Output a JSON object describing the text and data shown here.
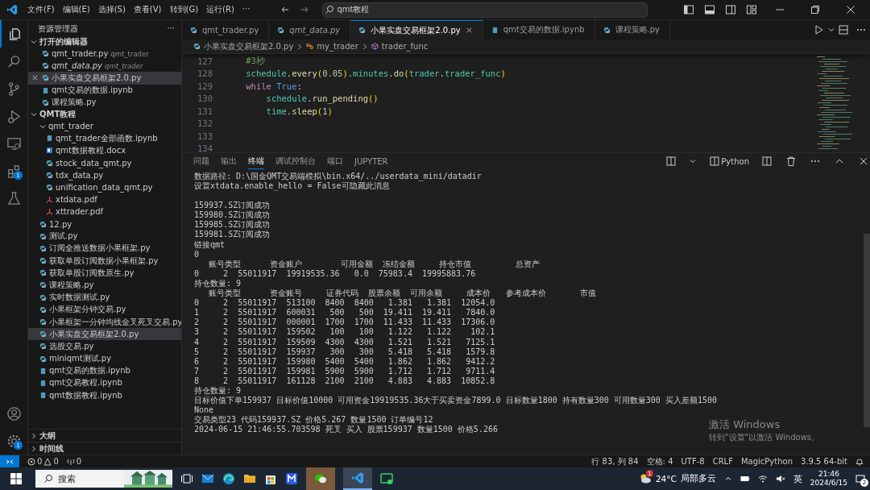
{
  "menu": [
    "文件(F)",
    "编辑(E)",
    "选择(S)",
    "查看(V)",
    "转到(G)",
    "运行(R)",
    "···"
  ],
  "command_center": {
    "value": "qmt教程"
  },
  "activity_bar": {
    "extensions_badge": "1",
    "settings_badge": "1"
  },
  "sidebar": {
    "title": "资源管理器",
    "more": "···",
    "open_editors": {
      "title": "打开的编辑器",
      "expanded": true,
      "items": [
        {
          "name": "qmt_trader.py",
          "folder": "qmt_trader",
          "kind": "py",
          "preview": false,
          "selected": false
        },
        {
          "name": "qmt_data.py",
          "folder": "qmt_trader",
          "kind": "py",
          "preview": true,
          "selected": false
        },
        {
          "name": "小果实盘交易框架2.0.py",
          "kind": "py",
          "preview": false,
          "selected": true
        },
        {
          "name": "qmt交易的数据.ipynb",
          "kind": "ipynb",
          "preview": false,
          "selected": false
        },
        {
          "name": "课程策略.py",
          "kind": "py",
          "preview": false,
          "selected": false
        }
      ]
    },
    "folder": {
      "title": "QMT教程",
      "expanded": true,
      "items": [
        {
          "name": "qmt_trader",
          "kind": "folder",
          "expanded": true,
          "selected": false,
          "children": [
            {
              "name": "qmt_trader全部函数.ipynb",
              "kind": "ipynb",
              "selected": false
            },
            {
              "name": "qmt数据教程.docx",
              "kind": "docx",
              "selected": false
            },
            {
              "name": "stock_data_qmt.py",
              "kind": "py",
              "selected": false
            },
            {
              "name": "tdx_data.py",
              "kind": "py",
              "selected": false
            },
            {
              "name": "unification_data_qmt.py",
              "kind": "py",
              "selected": false
            },
            {
              "name": "xtdata.pdf",
              "kind": "pdf",
              "selected": false
            },
            {
              "name": "xttrader.pdf",
              "kind": "pdf",
              "selected": false
            }
          ]
        },
        {
          "name": "12.py",
          "kind": "py",
          "selected": false
        },
        {
          "name": "测试.py",
          "kind": "py",
          "selected": false
        },
        {
          "name": "订阅全推送数据小果框架.py",
          "kind": "py",
          "selected": false
        },
        {
          "name": "获取单股订阅数据小果框架.py",
          "kind": "py",
          "selected": false
        },
        {
          "name": "获取单股订阅数原生.py",
          "kind": "py",
          "selected": false
        },
        {
          "name": "课程策略.py",
          "kind": "py",
          "selected": false
        },
        {
          "name": "实时数据测试.py",
          "kind": "py",
          "selected": false
        },
        {
          "name": "小果框架分钟交易.py",
          "kind": "py",
          "selected": false
        },
        {
          "name": "小果框架一分钟均线金叉死叉交易.py",
          "kind": "py",
          "selected": false
        },
        {
          "name": "小果实盘交易框架2.0.py",
          "kind": "py",
          "selected": true
        },
        {
          "name": "选股交易.py",
          "kind": "py",
          "selected": false
        },
        {
          "name": "miniqmt测试.py",
          "kind": "py",
          "selected": false
        },
        {
          "name": "qmt交易的数据.ipynb",
          "kind": "ipynb",
          "selected": false
        },
        {
          "name": "qmt交易教程.ipynb",
          "kind": "ipynb",
          "selected": false
        },
        {
          "name": "qmt数据教程.ipynb",
          "kind": "ipynb",
          "selected": false
        }
      ]
    },
    "sections": [
      {
        "title": "大纲",
        "expanded": false
      },
      {
        "title": "时间线",
        "expanded": false
      }
    ]
  },
  "tabs": [
    {
      "label": "qmt_trader.py",
      "kind": "py",
      "preview": false,
      "selected": false
    },
    {
      "label": "qmt_data.py",
      "kind": "py",
      "preview": true,
      "selected": false
    },
    {
      "label": "小果实盘交易框架2.0.py",
      "kind": "py",
      "preview": false,
      "selected": true
    },
    {
      "label": "qmt交易的数据.ipynb",
      "kind": "ipynb",
      "preview": false,
      "selected": false
    },
    {
      "label": "课程策略.py",
      "kind": "py",
      "preview": false,
      "selected": false
    }
  ],
  "breadcrumb": [
    "小果实盘交易框架2.0.py",
    "my_trader",
    "trader_func"
  ],
  "code": [
    {
      "number": "127",
      "tokens": [
        {
          "text": "    #3秒",
          "kind": "comment"
        }
      ]
    },
    {
      "number": "128",
      "tokens": [
        {
          "text": "    schedule",
          "kind": "var"
        },
        {
          "text": ".",
          "kind": "plain"
        },
        {
          "text": "every",
          "kind": "func"
        },
        {
          "text": "(",
          "kind": "paren"
        },
        {
          "text": "0.05",
          "kind": "num"
        },
        {
          "text": ")",
          "kind": "paren"
        },
        {
          "text": ".",
          "kind": "plain"
        },
        {
          "text": "minutes",
          "kind": "var"
        },
        {
          "text": ".",
          "kind": "plain"
        },
        {
          "text": "do",
          "kind": "func"
        },
        {
          "text": "(",
          "kind": "paren"
        },
        {
          "text": "trader",
          "kind": "var"
        },
        {
          "text": ".",
          "kind": "plain"
        },
        {
          "text": "trader_func",
          "kind": "var"
        },
        {
          "text": ")",
          "kind": "paren"
        }
      ]
    },
    {
      "number": "129",
      "tokens": [
        {
          "text": "    while",
          "kind": "kw"
        },
        {
          "text": " True",
          "kind": "const"
        },
        {
          "text": ":",
          "kind": "plain"
        }
      ]
    },
    {
      "number": "130",
      "tokens": [
        {
          "text": "        schedule",
          "kind": "var"
        },
        {
          "text": ".",
          "kind": "plain"
        },
        {
          "text": "run_pending",
          "kind": "func"
        },
        {
          "text": "()",
          "kind": "paren"
        }
      ]
    },
    {
      "number": "131",
      "tokens": [
        {
          "text": "        time",
          "kind": "var"
        },
        {
          "text": ".",
          "kind": "plain"
        },
        {
          "text": "sleep",
          "kind": "func"
        },
        {
          "text": "(",
          "kind": "paren"
        },
        {
          "text": "1",
          "kind": "num"
        },
        {
          "text": ")",
          "kind": "paren"
        }
      ]
    },
    {
      "number": "132"
    },
    {
      "number": "133"
    },
    {
      "number": "134"
    }
  ],
  "panel": {
    "tabs": [
      {
        "label": "问题",
        "selected": false
      },
      {
        "label": "输出",
        "selected": false
      },
      {
        "label": "终端",
        "selected": true
      },
      {
        "label": "调试控制台",
        "selected": false
      },
      {
        "label": "端口",
        "selected": false
      },
      {
        "label": "JUPYTER",
        "selected": false
      }
    ],
    "terminal_name": "Python",
    "terminal": [
      [
        "数据路径: D:\\国金QMT交易端模拟\\bin.x64/../userdata_mini/datadir",
        "设置xtdata.enable_hello = False可隐藏此消息"
      ],
      [
        "159937.SZ订阅成功",
        "159980.SZ订阅成功",
        "159985.SZ订阅成功",
        "159981.SZ订阅成功",
        "链接qmt",
        "0",
        "   账号类型      资金账户        可用金额  冻结金额     持仓市值         总资产",
        "0     2  55011917  19919535.36   0.0  75983.4  19995883.76",
        "持仓数量: 9",
        "   账号类型      资金账号     证券代码  股票余额  可用余额     成本价   参考成本价       市值",
        "0     2  55011917  513100  8400  8400   1.381   1.381  12054.0",
        "1     2  55011917  600031   500   500  19.411  19.411   7840.0",
        "2     2  55011917  000001  1700  1700  11.433  11.433  17306.0",
        "3     2  55011917  159502   100   100   1.122   1.122    102.1",
        "4     2  55011917  159509  4300  4300   1.521   1.521   7125.1",
        "5     2  55011917  159937   300   300   5.418   5.418   1579.8",
        "6     2  55011917  159980  5400  5400   1.862   1.862   9412.2",
        "7     2  55011917  159981  5900  5900   1.712   1.712   9711.4",
        "8     2  55011917  161128  2100  2100   4.883   4.883  10852.8",
        "持仓数量: 9",
        "目标价值下单159937 目标价值10000 可用资金19919535.36大于买卖资金7899.0 目标数量1800 持有数量300 可用数量300 买入差额1500",
        "None",
        "交易类型23 代码159937.SZ 价格5.267 数量1500 订单编号12",
        "2024-06-15 21:46:55.703598 死叉 买入 股票159937 数量1500 价格5.266"
      ]
    ]
  },
  "status_bar": {
    "errors": "0",
    "warnings": "0",
    "ports": "0",
    "right": [
      "行 83, 列 84",
      "空格: 4",
      "UTF-8",
      "CRLF",
      "MagicPython",
      "3.9.5 64-bit"
    ]
  },
  "activation": {
    "title": "激活 Windows",
    "hint": "转到\"设置\"以激活 Windows。"
  },
  "taskbar": {
    "search": "搜索",
    "weather": "24°C",
    "weather_text": "局部多云",
    "ime": "英",
    "time": "21:46",
    "date": "2024/6/15",
    "notifications": "2",
    "weather_badge": "1"
  }
}
